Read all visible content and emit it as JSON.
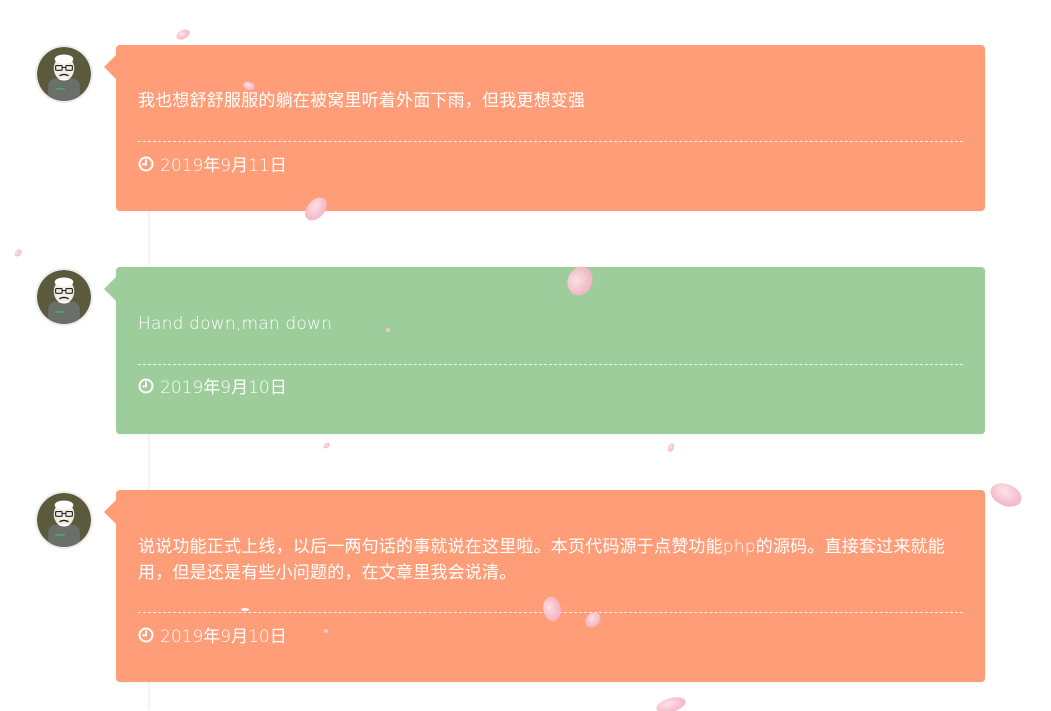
{
  "colors": {
    "orange_card": "#ff9d79",
    "green_card": "#9ccd9a",
    "timeline": "#f4f4f4",
    "petal": "#f7bcca"
  },
  "avatar_icon": "cartoon-old-man-avatar",
  "clock_icon": "clock-icon",
  "posts": [
    {
      "text": "我也想舒舒服服的躺在被窝里听着外面下雨，但我更想变强",
      "date": "2019年9月11日",
      "color": "orange"
    },
    {
      "text": "Hand down,man down",
      "date": "2019年9月10日",
      "color": "green"
    },
    {
      "text": "说说功能正式上线，以后一两句话的事就说在这里啦。本页代码源于点赞功能php的源码。直接套过来就能用，但是还是有些小问题的，在文章里我会说清。",
      "date": "2019年9月10日",
      "color": "orange"
    }
  ]
}
